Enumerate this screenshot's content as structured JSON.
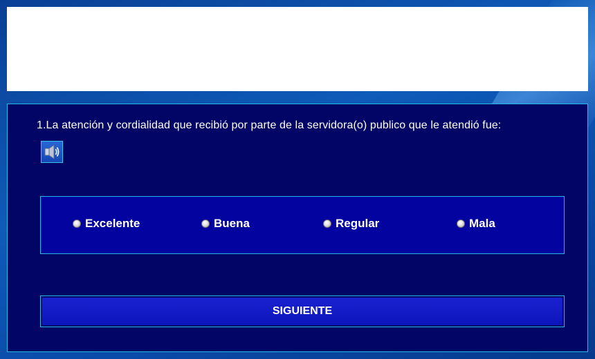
{
  "banner": {},
  "survey": {
    "question": "1.La atención y cordialidad que recibió por parte de la servidora(o) publico que le atendió fue:",
    "audio_icon": "speaker-icon",
    "options": [
      {
        "label": "Excelente"
      },
      {
        "label": "Buena"
      },
      {
        "label": "Regular"
      },
      {
        "label": "Mala"
      }
    ],
    "next_label": "SIGUIENTE"
  },
  "colors": {
    "panel_bg": "#020566",
    "options_bg": "#0303a0",
    "border": "#29b8e8",
    "button_bg": "#1a22d0",
    "page_bg": "#0e5bb8"
  }
}
